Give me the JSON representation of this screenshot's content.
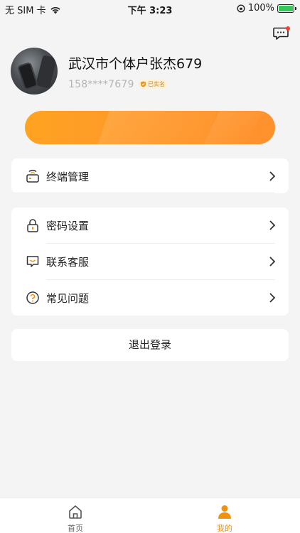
{
  "status_bar": {
    "carrier": "无 SIM 卡",
    "time": "下午 3:23",
    "battery": "100%"
  },
  "profile": {
    "name": "武汉市个体户张杰679",
    "phone": "158****7679",
    "verified_label": "已实名"
  },
  "colors": {
    "accent": "#F2900F",
    "banner": "#FF9A2A"
  },
  "menu_group_1": [
    {
      "label": "终端管理",
      "icon": "terminal-device-icon"
    }
  ],
  "menu_group_2": [
    {
      "label": "密码设置",
      "icon": "lock-icon"
    },
    {
      "label": "联系客服",
      "icon": "customer-service-icon"
    },
    {
      "label": "常见问题",
      "icon": "question-icon"
    }
  ],
  "logout_label": "退出登录",
  "tabs": [
    {
      "label": "首页",
      "icon": "home-icon",
      "active": false
    },
    {
      "label": "我的",
      "icon": "user-icon",
      "active": true
    }
  ]
}
